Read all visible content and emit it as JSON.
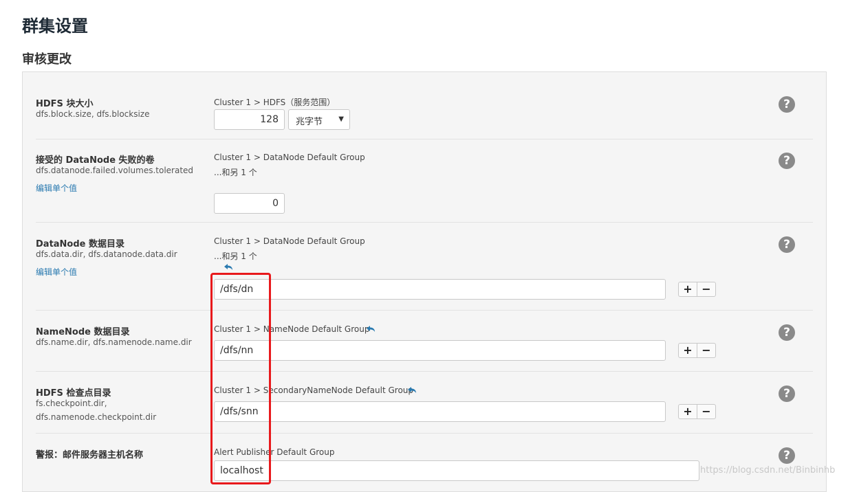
{
  "page": {
    "title": "群集设置",
    "section_title": "审核更改"
  },
  "settings": [
    {
      "name": "HDFS 块大小",
      "keys": "dfs.block.size, dfs.blocksize",
      "scope": "Cluster 1 > HDFS（服务范围）",
      "value": "128",
      "unit": "兆字节"
    },
    {
      "name": "接受的 DataNode 失败的卷",
      "keys": "dfs.datanode.failed.volumes.tolerated",
      "edit_link": "编辑单个值",
      "scope": "Cluster 1 > DataNode Default Group",
      "more": "...和另 1 个",
      "value": "0"
    },
    {
      "name": "DataNode 数据目录",
      "keys": "dfs.data.dir, dfs.datanode.data.dir",
      "edit_link": "编辑单个值",
      "scope": "Cluster 1 > DataNode Default Group",
      "more": "...和另 1 个",
      "value": "/dfs/dn"
    },
    {
      "name": "NameNode 数据目录",
      "keys": "dfs.name.dir, dfs.namenode.name.dir",
      "scope": "Cluster 1 > NameNode Default Group",
      "value": "/dfs/nn"
    },
    {
      "name": "HDFS 检查点目录",
      "keys_line1": "fs.checkpoint.dir,",
      "keys_line2": "dfs.namenode.checkpoint.dir",
      "scope": "Cluster 1 > SecondaryNameNode Default Group",
      "value": "/dfs/snn"
    },
    {
      "name": "警报：邮件服务器主机名称",
      "scope": "Alert Publisher Default Group",
      "value": "localhost"
    }
  ],
  "buttons": {
    "add": "+",
    "remove": "−",
    "help": "?"
  },
  "watermark": "https://blog.csdn.net/Binbinhb",
  "colors": {
    "highlight": "#e8191c",
    "link": "#2a7ab0",
    "help_icon": "#8a8a8a",
    "undo_icon": "#2a7ab0"
  }
}
